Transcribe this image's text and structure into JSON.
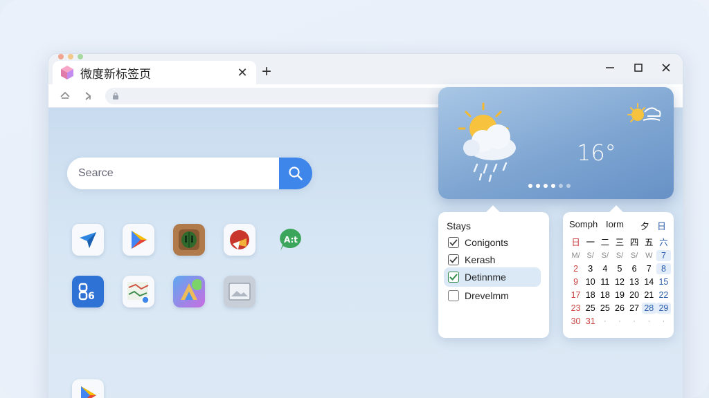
{
  "browser": {
    "tab_title": "微度新标签页",
    "tab_close": "✕",
    "new_tab": "+"
  },
  "search": {
    "placeholder": "Searce"
  },
  "weather": {
    "temperature": "16°"
  },
  "stays": {
    "title": "Stays",
    "items": [
      {
        "label": "Conigonts",
        "checked": true
      },
      {
        "label": "Kerash",
        "checked": true
      },
      {
        "label": "Detinnme",
        "checked": true,
        "active": true
      },
      {
        "label": "Drevelmm",
        "checked": false
      }
    ]
  },
  "calendar": {
    "header": [
      "Somph",
      "Iorm",
      "夕",
      "日"
    ],
    "weekday_row": [
      "日",
      "一",
      "二",
      "三",
      "四",
      "五",
      "六"
    ],
    "rows": [
      [
        "M/",
        "S/",
        "S/",
        "S/",
        "S/",
        "W",
        "7"
      ],
      [
        "2",
        "3",
        "4",
        "5",
        "6",
        "7",
        "8"
      ],
      [
        "9",
        "10",
        "11",
        "12",
        "13",
        "14",
        "15"
      ],
      [
        "17",
        "18",
        "18",
        "19",
        "20",
        "21",
        "22"
      ],
      [
        "23",
        "25",
        "25",
        "26",
        "27",
        "28",
        "29"
      ],
      [
        "30",
        "31",
        "·",
        "·",
        "·",
        "·",
        "·"
      ]
    ]
  },
  "colors": {
    "accent": "#3f86ea",
    "weather_top": "#a9c7e6",
    "weather_bottom": "#6791c6"
  },
  "apps": [
    {
      "icon": "paper-plane-app-icon"
    },
    {
      "icon": "play-store-app-icon"
    },
    {
      "icon": "cactus-game-app-icon"
    },
    {
      "icon": "red-circle-app-icon"
    },
    {
      "icon": "green-chat-app-icon"
    },
    {
      "icon": "blue-tiles-app-icon"
    },
    {
      "icon": "map-app-icon"
    },
    {
      "icon": "colorful-a-app-icon"
    },
    {
      "icon": "image-gallery-app-icon"
    },
    {
      "icon": "play-store-app-icon-2"
    }
  ]
}
